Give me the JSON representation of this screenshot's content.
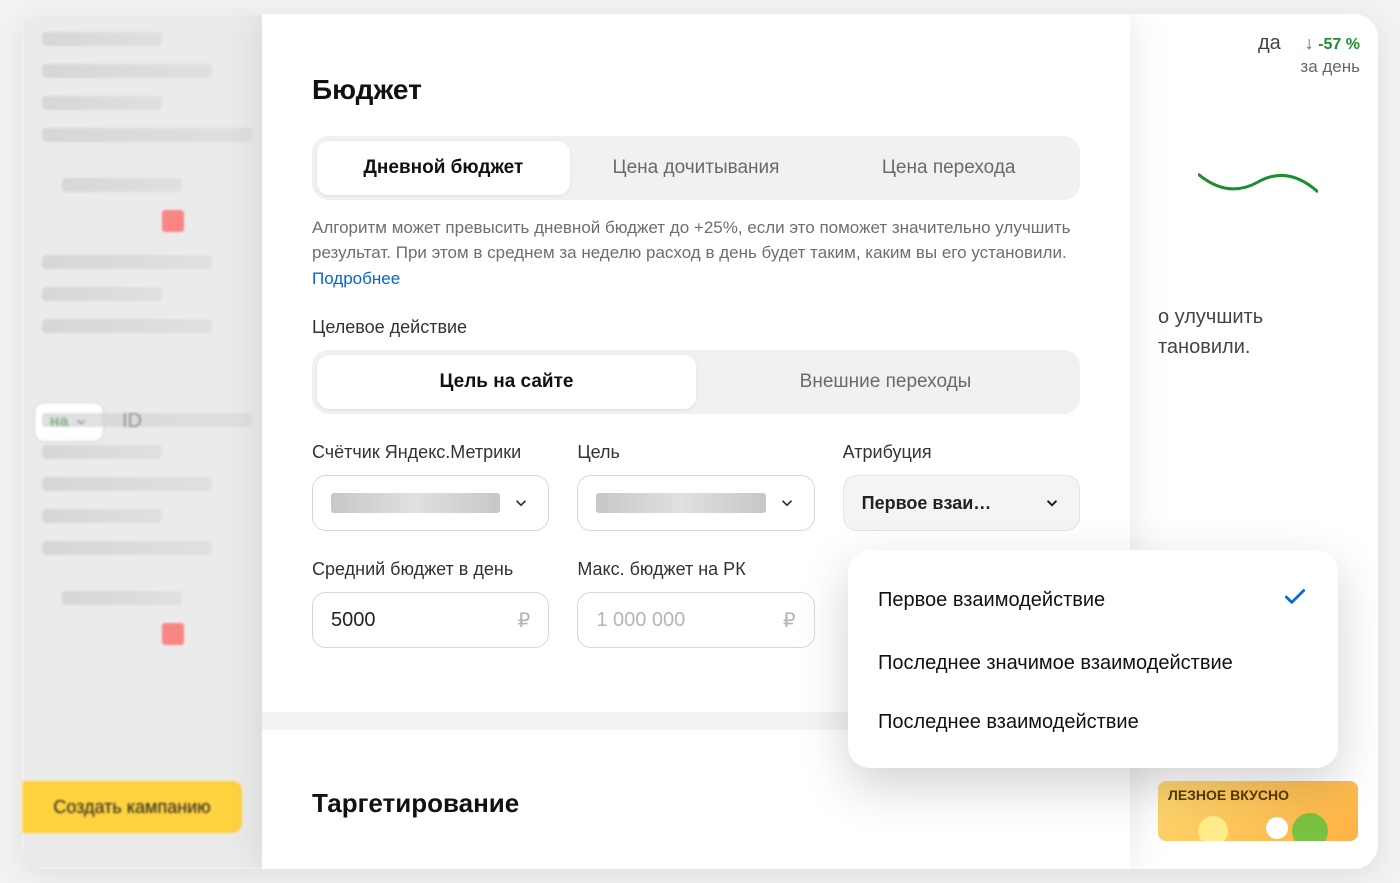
{
  "bg": {
    "top_right_delta": "-57 %",
    "top_right_sub": "за день",
    "top_right_trailing": "да",
    "right_text_line1": "о улучшить",
    "right_text_line2": "тановили.",
    "banner_text": "ЛЕЗНОЕ ВКУСНО",
    "left_pill_text": "на",
    "left_id_label": "ID",
    "create_button": "Создать кампанию"
  },
  "modal": {
    "title": "Бюджет",
    "budget_tabs": [
      {
        "label": "Дневной бюджет",
        "active": true
      },
      {
        "label": "Цена дочитывания",
        "active": false
      },
      {
        "label": "Цена перехода",
        "active": false
      }
    ],
    "helper_text": "Алгоритм может превысить дневной бюджет до +25%, если это поможет значительно улучшить результат. При этом в среднем за неделю расход в день будет таким, каким вы его установили.",
    "learn_more": "Подробнее",
    "target_action_label": "Целевое действие",
    "target_action_tabs": [
      {
        "label": "Цель на сайте",
        "active": true
      },
      {
        "label": "Внешние переходы",
        "active": false
      }
    ],
    "counter": {
      "label": "Счётчик Яндекс.Метрики"
    },
    "goal": {
      "label": "Цель"
    },
    "attribution": {
      "label": "Атрибуция",
      "selected": "Первое взаи…",
      "options": [
        {
          "label": "Первое взаимодействие",
          "selected": true
        },
        {
          "label": "Последнее значимое взаимодействие",
          "selected": false
        },
        {
          "label": "Последнее взаимодействие",
          "selected": false
        }
      ]
    },
    "avg_budget": {
      "label": "Средний бюджет в день",
      "value": "5000",
      "currency": "₽"
    },
    "max_budget": {
      "label": "Макс. бюджет на РК",
      "placeholder": "1 000 000",
      "currency": "₽"
    },
    "section2_title": "Таргетирование"
  }
}
